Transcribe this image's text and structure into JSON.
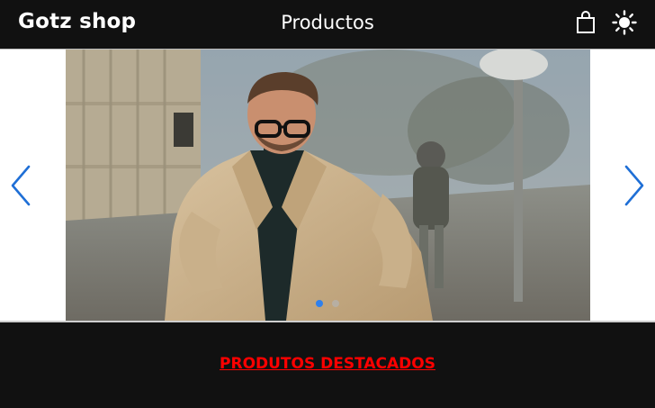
{
  "header": {
    "brand": "Gotz shop",
    "nav_title": "Productos",
    "icons": [
      "shopping-bag-icon",
      "sun-icon"
    ]
  },
  "carousel": {
    "slide_count": 2,
    "active_index": 0,
    "prev_icon": "chevron-left-icon",
    "next_icon": "chevron-right-icon"
  },
  "featured": {
    "label": "PRODUTOS DESTACADOS"
  },
  "colors": {
    "background": "#111111",
    "accent": "#2f80ed",
    "link": "#ff0000"
  }
}
